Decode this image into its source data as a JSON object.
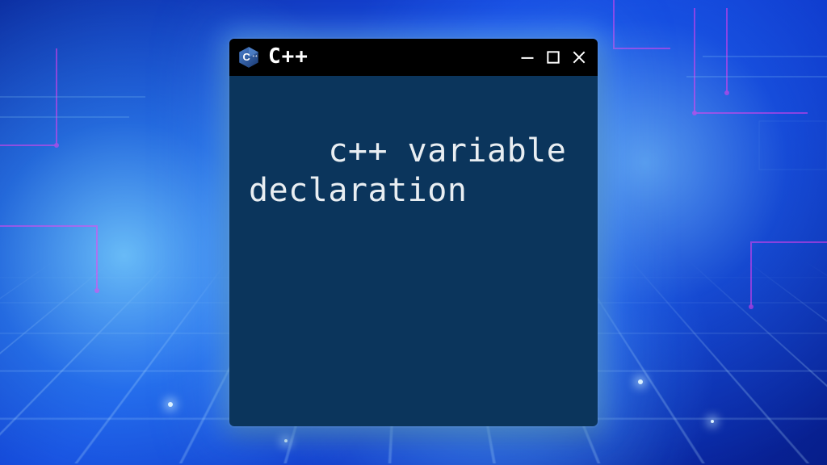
{
  "window": {
    "title": "C++",
    "logo_letter": "C",
    "logo_plus": "++",
    "controls": {
      "minimize": "minimize",
      "maximize": "maximize",
      "close": "close"
    }
  },
  "body": {
    "text": "c++ variable declaration"
  },
  "colors": {
    "titlebar_bg": "#000000",
    "window_bg": "#0b355c",
    "text": "#e9eef2",
    "logo_dark": "#1f3b73",
    "logo_light": "#3f6db8"
  }
}
